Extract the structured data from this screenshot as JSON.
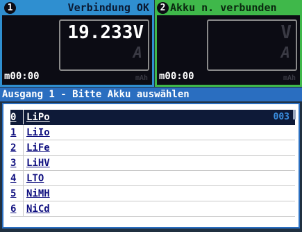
{
  "panel1": {
    "number": "1",
    "status": "Verbindung OK",
    "voltage": "19.233V",
    "current_unit": "A",
    "timer": "m00:00",
    "capacity_unit": "mAh"
  },
  "panel2": {
    "number": "2",
    "status": "Akku n. verbunden",
    "voltage_unit": "V",
    "current_unit": "A",
    "timer": "m00:00",
    "capacity_unit": "mAh"
  },
  "section_title": "Ausgang 1 - Bitte Akku auswählen",
  "list": {
    "selected_count": "003",
    "items": [
      {
        "index": "0",
        "label": "LiPo"
      },
      {
        "index": "1",
        "label": "LiIo"
      },
      {
        "index": "2",
        "label": "LiFe"
      },
      {
        "index": "3",
        "label": "LiHV"
      },
      {
        "index": "4",
        "label": "LTO"
      },
      {
        "index": "5",
        "label": "NiMH"
      },
      {
        "index": "6",
        "label": "NiCd"
      }
    ]
  },
  "colors": {
    "panel1_accent": "#2f8fd0",
    "panel2_accent": "#3fb84a",
    "section_bg": "#2a6ec0",
    "selected_row": "#0e1a38"
  }
}
